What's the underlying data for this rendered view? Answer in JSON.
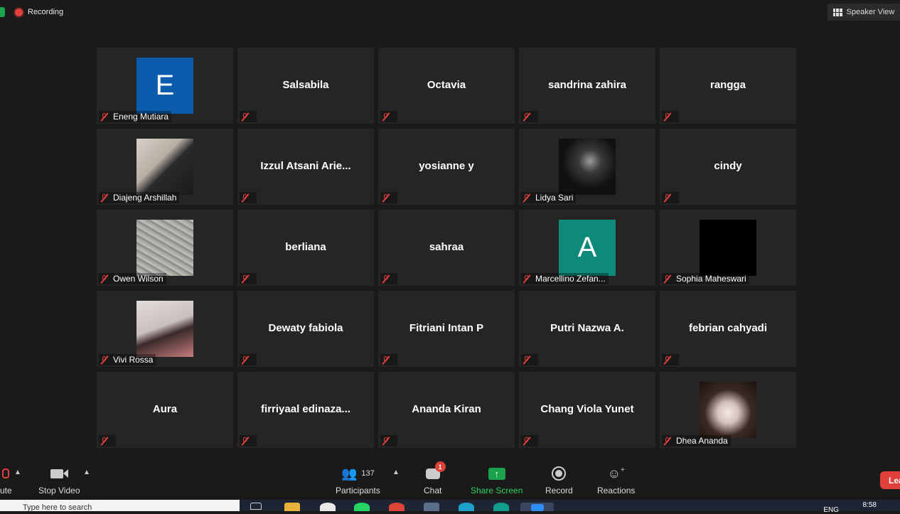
{
  "top_bar": {
    "recording_label": "Recording",
    "speaker_view_label": "Speaker View"
  },
  "participants": [
    {
      "name": "Eneng Mutiara",
      "display": "avatar-letter",
      "letter": "E",
      "color": "#0b5cad"
    },
    {
      "name": "Salsabila",
      "display": "name"
    },
    {
      "name": "Octavia",
      "display": "name"
    },
    {
      "name": "sandrina zahira",
      "display": "name"
    },
    {
      "name": "rangga",
      "display": "name"
    },
    {
      "name": "Diajeng Arshillah",
      "display": "photo"
    },
    {
      "name": "Izzul Atsani Arie...",
      "display": "name"
    },
    {
      "name": "yosianne y",
      "display": "name"
    },
    {
      "name": "Lidya Sari",
      "display": "photo"
    },
    {
      "name": "cindy",
      "display": "name"
    },
    {
      "name": "Owen Wilson",
      "display": "photo"
    },
    {
      "name": "berliana",
      "display": "name"
    },
    {
      "name": "sahraa",
      "display": "name"
    },
    {
      "name": "Marcellino Zefan...",
      "display": "avatar-letter",
      "letter": "A",
      "color": "#0e8a7a"
    },
    {
      "name": "Sophia Maheswari",
      "display": "photo"
    },
    {
      "name": "Vivi Rossa",
      "display": "photo"
    },
    {
      "name": "Dewaty fabiola",
      "display": "name"
    },
    {
      "name": "Fitriani Intan P",
      "display": "name"
    },
    {
      "name": "Putri Nazwa A.",
      "display": "name"
    },
    {
      "name": "febrian cahyadi",
      "display": "name"
    },
    {
      "name": "Aura",
      "display": "name"
    },
    {
      "name": "firriyaal  edinaza...",
      "display": "name"
    },
    {
      "name": "Ananda Kiran",
      "display": "name"
    },
    {
      "name": "Chang Viola Yunet",
      "display": "name"
    },
    {
      "name": "Dhea Ananda",
      "display": "photo"
    }
  ],
  "toolbar": {
    "unmute_label": "ute",
    "stop_video_label": "Stop Video",
    "participants_label": "Participants",
    "participants_count": "137",
    "chat_label": "Chat",
    "chat_badge": "1",
    "share_screen_label": "Share Screen",
    "record_label": "Record",
    "reactions_label": "Reactions",
    "leave_label": "Lea"
  },
  "taskbar": {
    "search_text": "Type here to search",
    "language": "ENG",
    "time": "8:58"
  },
  "colors": {
    "accent_green": "#1aa34a",
    "leave_red": "#e0413b",
    "mic_muted_red": "#e0413b"
  }
}
